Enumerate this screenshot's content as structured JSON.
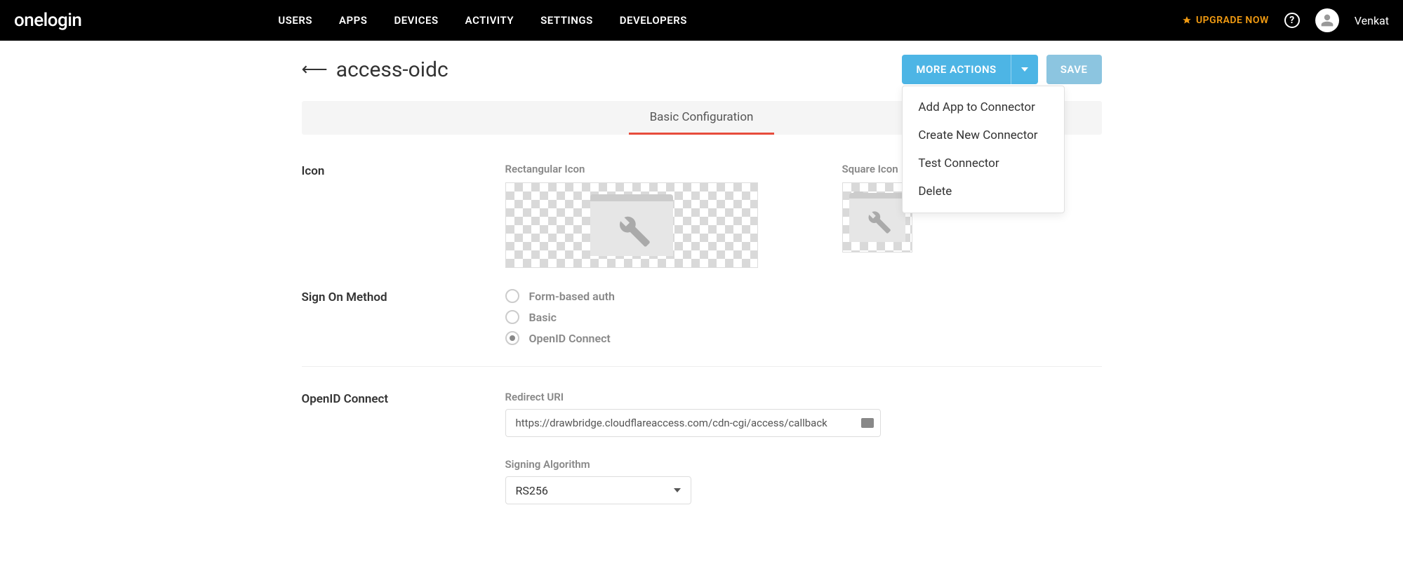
{
  "brand": "onelogin",
  "nav": [
    "USERS",
    "APPS",
    "DEVICES",
    "ACTIVITY",
    "SETTINGS",
    "DEVELOPERS"
  ],
  "upgrade": "UPGRADE NOW",
  "username": "Venkat",
  "page": {
    "title": "access-oidc",
    "more_actions": "MORE ACTIONS",
    "save": "SAVE",
    "dropdown": [
      "Add App to Connector",
      "Create New Connector",
      "Test Connector",
      "Delete"
    ]
  },
  "tabs": {
    "active": "Basic Configuration"
  },
  "sections": {
    "icon": {
      "heading": "Icon",
      "rect_label": "Rectangular Icon",
      "square_label": "Square Icon"
    },
    "sign_on": {
      "heading": "Sign On Method",
      "options": [
        "Form-based auth",
        "Basic",
        "OpenID Connect"
      ],
      "selected_index": 2
    },
    "oidc": {
      "heading": "OpenID Connect",
      "redirect_label": "Redirect URI",
      "redirect_value": "https://drawbridge.cloudflareaccess.com/cdn-cgi/access/callback",
      "signing_label": "Signing Algorithm",
      "signing_value": "RS256"
    }
  }
}
